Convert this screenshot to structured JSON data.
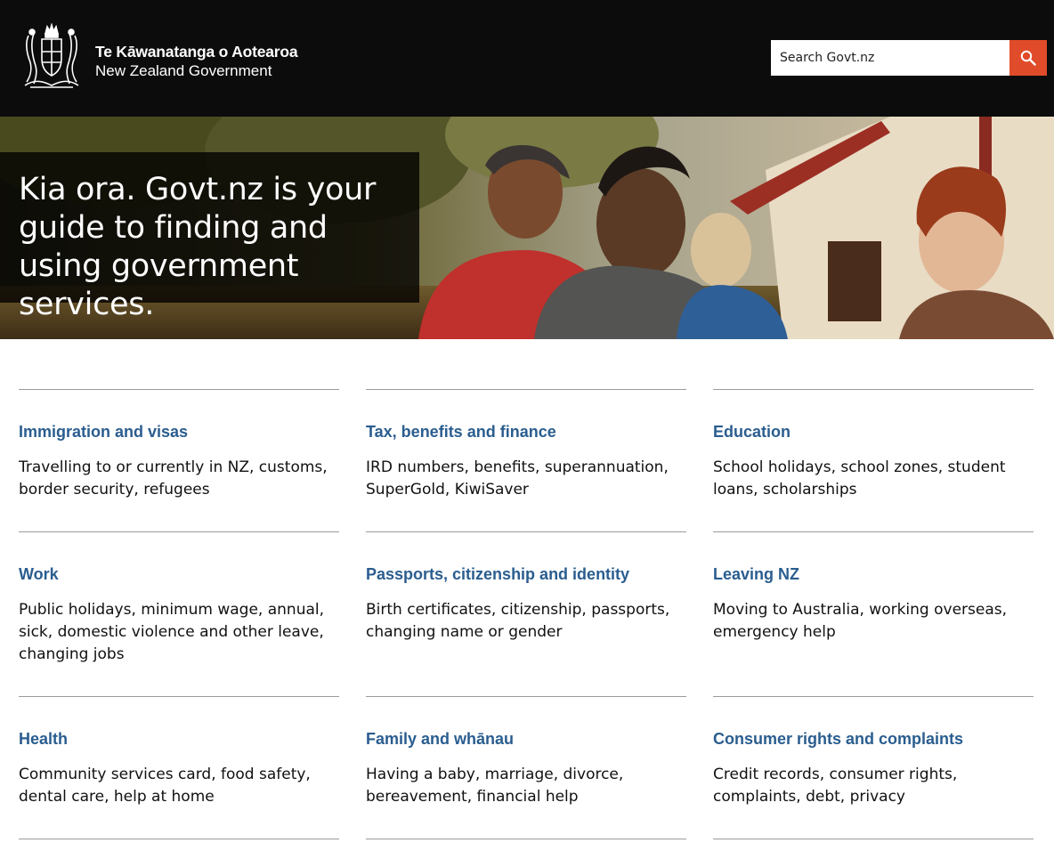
{
  "header": {
    "brand_maori": "Te Kāwanatanga o Aotearoa",
    "brand_english": "New Zealand Government",
    "logo_icon": "nz-coat-of-arms-icon",
    "search_placeholder": "Search Govt.nz",
    "search_icon": "search-icon",
    "search_button_color": "#e04b2a"
  },
  "hero": {
    "heading": "Kia ora. Govt.nz is your guide to finding and using government services."
  },
  "topics": [
    {
      "title": "Immigration and visas",
      "description": "Travelling to or currently in NZ, customs, border security, refugees"
    },
    {
      "title": "Tax, benefits and finance",
      "description": "IRD numbers, benefits, superannuation, SuperGold, KiwiSaver"
    },
    {
      "title": "Education",
      "description": "School holidays, school zones, student loans, scholarships"
    },
    {
      "title": "Work",
      "description": "Public holidays, minimum wage, annual, sick, domestic violence and other leave, changing jobs"
    },
    {
      "title": "Passports, citizenship and identity",
      "description": "Birth certificates, citizenship, passports, changing name or gender"
    },
    {
      "title": "Leaving NZ",
      "description": "Moving to Australia, working overseas, emergency help"
    },
    {
      "title": "Health",
      "description": "Community services card, food safety, dental care, help at home"
    },
    {
      "title": "Family and whānau",
      "description": "Having a baby, marriage, divorce, bereavement, financial help"
    },
    {
      "title": "Consumer rights and complaints",
      "description": "Credit records, consumer rights, complaints, debt, privacy"
    }
  ],
  "colors": {
    "header_bg": "#0c0c0c",
    "link": "#2a5d8f",
    "rule": "#9b9b9b"
  }
}
